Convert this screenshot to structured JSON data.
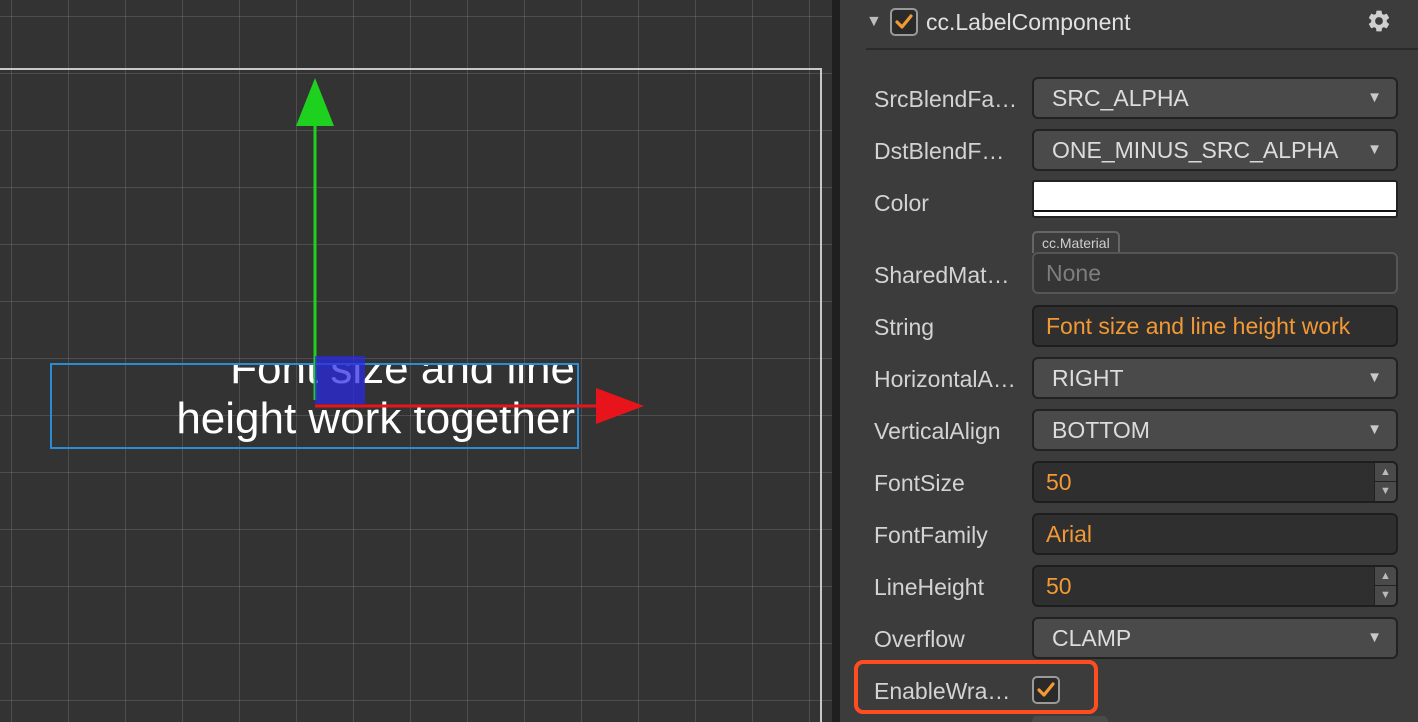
{
  "scene": {
    "label_text": "Font size and line\nheight work together"
  },
  "component": {
    "title": "cc.LabelComponent",
    "enabled": true
  },
  "properties": {
    "src_blend": {
      "label": "SrcBlendFa…",
      "value": "SRC_ALPHA"
    },
    "dst_blend": {
      "label": "DstBlendF…",
      "value": "ONE_MINUS_SRC_ALPHA"
    },
    "color": {
      "label": "Color",
      "value": "#ffffff"
    },
    "shared_material": {
      "label": "SharedMat…",
      "tag": "cc.Material",
      "value": "None"
    },
    "string": {
      "label": "String",
      "value": "Font size and line height work"
    },
    "horizontal_align": {
      "label": "HorizontalA…",
      "value": "RIGHT"
    },
    "vertical_align": {
      "label": "VerticalAlign",
      "value": "BOTTOM"
    },
    "font_size": {
      "label": "FontSize",
      "value": "50"
    },
    "font_family": {
      "label": "FontFamily",
      "value": "Arial"
    },
    "line_height": {
      "label": "LineHeight",
      "value": "50"
    },
    "overflow": {
      "label": "Overflow",
      "value": "CLAMP"
    },
    "enable_wrap": {
      "label": "EnableWra…",
      "checked": true
    }
  },
  "icons": {
    "collapse": "triangle-down-icon",
    "settings": "gear-icon",
    "dropdown": "caret-down-icon",
    "check": "checkmark-icon"
  },
  "colors": {
    "accent_orange": "#f29935",
    "highlight_red": "#ff4d1f",
    "selection_blue": "#2b8cd6",
    "gizmo_x": "#e8141b",
    "gizmo_y": "#1fd11f"
  }
}
